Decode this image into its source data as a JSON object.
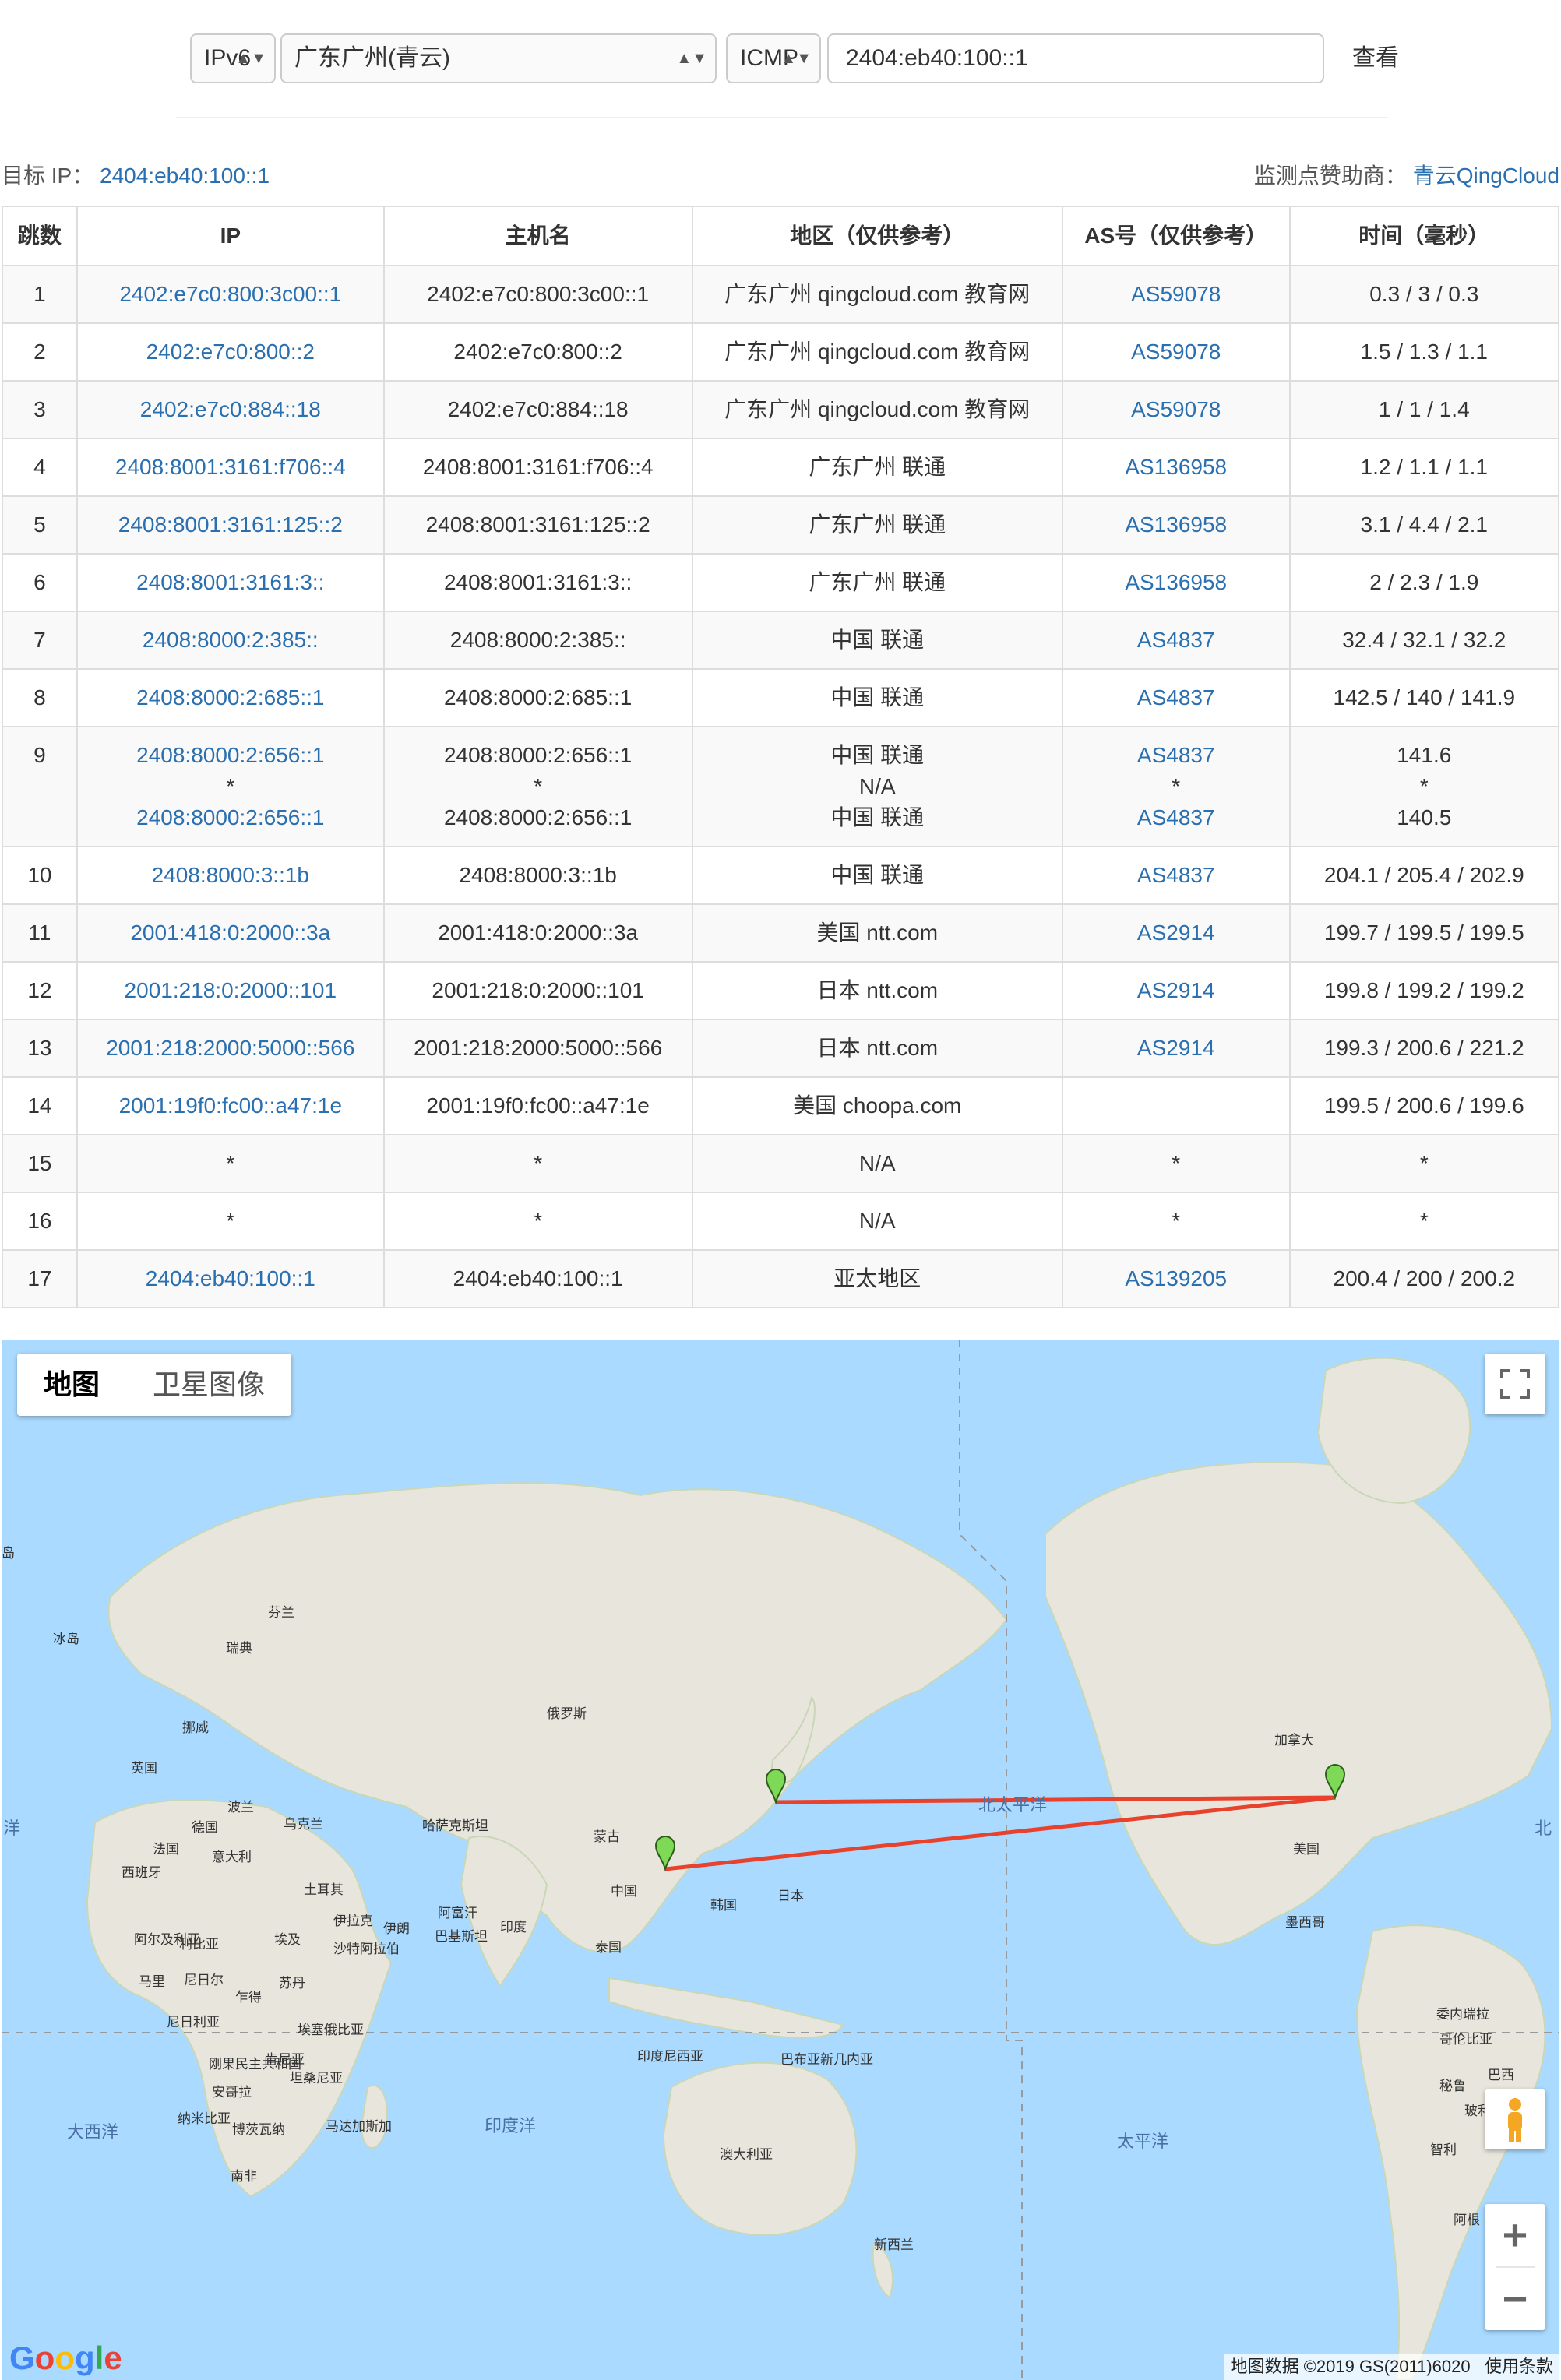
{
  "toolbar": {
    "protocol": "IPv6",
    "node": "广东广州(青云)",
    "method": "ICMP",
    "target_value": "2404:eb40:100::1",
    "submit_label": "查看"
  },
  "info": {
    "target_label": "目标 IP：",
    "target_ip": "2404:eb40:100::1",
    "sponsor_label": "监测点赞助商：",
    "sponsor_name": "青云QingCloud"
  },
  "table": {
    "headers": [
      "跳数",
      "IP",
      "主机名",
      "地区（仅供参考）",
      "AS号（仅供参考）",
      "时间（毫秒）"
    ],
    "rows": [
      {
        "hop": "1",
        "ip": [
          "2402:e7c0:800:3c00::1"
        ],
        "host": [
          "2402:e7c0:800:3c00::1"
        ],
        "region": [
          "广东广州 qingcloud.com 教育网"
        ],
        "as": [
          "AS59078"
        ],
        "time": [
          "0.3 / 3 / 0.3"
        ]
      },
      {
        "hop": "2",
        "ip": [
          "2402:e7c0:800::2"
        ],
        "host": [
          "2402:e7c0:800::2"
        ],
        "region": [
          "广东广州 qingcloud.com 教育网"
        ],
        "as": [
          "AS59078"
        ],
        "time": [
          "1.5 / 1.3 / 1.1"
        ]
      },
      {
        "hop": "3",
        "ip": [
          "2402:e7c0:884::18"
        ],
        "host": [
          "2402:e7c0:884::18"
        ],
        "region": [
          "广东广州 qingcloud.com 教育网"
        ],
        "as": [
          "AS59078"
        ],
        "time": [
          "1 / 1 / 1.4"
        ]
      },
      {
        "hop": "4",
        "ip": [
          "2408:8001:3161:f706::4"
        ],
        "host": [
          "2408:8001:3161:f706::4"
        ],
        "region": [
          "广东广州 联通"
        ],
        "as": [
          "AS136958"
        ],
        "time": [
          "1.2 / 1.1 / 1.1"
        ]
      },
      {
        "hop": "5",
        "ip": [
          "2408:8001:3161:125::2"
        ],
        "host": [
          "2408:8001:3161:125::2"
        ],
        "region": [
          "广东广州 联通"
        ],
        "as": [
          "AS136958"
        ],
        "time": [
          "3.1 / 4.4 / 2.1"
        ]
      },
      {
        "hop": "6",
        "ip": [
          "2408:8001:3161:3::"
        ],
        "host": [
          "2408:8001:3161:3::"
        ],
        "region": [
          "广东广州 联通"
        ],
        "as": [
          "AS136958"
        ],
        "time": [
          "2 / 2.3 / 1.9"
        ]
      },
      {
        "hop": "7",
        "ip": [
          "2408:8000:2:385::"
        ],
        "host": [
          "2408:8000:2:385::"
        ],
        "region": [
          "中国 联通"
        ],
        "as": [
          "AS4837"
        ],
        "time": [
          "32.4 / 32.1 / 32.2"
        ]
      },
      {
        "hop": "8",
        "ip": [
          "2408:8000:2:685::1"
        ],
        "host": [
          "2408:8000:2:685::1"
        ],
        "region": [
          "中国 联通"
        ],
        "as": [
          "AS4837"
        ],
        "time": [
          "142.5 / 140 / 141.9"
        ]
      },
      {
        "hop": "9",
        "ip": [
          "2408:8000:2:656::1",
          "*",
          "2408:8000:2:656::1"
        ],
        "host": [
          "2408:8000:2:656::1",
          "*",
          "2408:8000:2:656::1"
        ],
        "region": [
          "中国 联通",
          "N/A",
          "中国 联通"
        ],
        "as": [
          "AS4837",
          "*",
          "AS4837"
        ],
        "time": [
          "141.6",
          "*",
          "140.5"
        ]
      },
      {
        "hop": "10",
        "ip": [
          "2408:8000:3::1b"
        ],
        "host": [
          "2408:8000:3::1b"
        ],
        "region": [
          "中国 联通"
        ],
        "as": [
          "AS4837"
        ],
        "time": [
          "204.1 / 205.4 / 202.9"
        ]
      },
      {
        "hop": "11",
        "ip": [
          "2001:418:0:2000::3a"
        ],
        "host": [
          "2001:418:0:2000::3a"
        ],
        "region": [
          "美国 ntt.com"
        ],
        "as": [
          "AS2914"
        ],
        "time": [
          "199.7 / 199.5 / 199.5"
        ]
      },
      {
        "hop": "12",
        "ip": [
          "2001:218:0:2000::101"
        ],
        "host": [
          "2001:218:0:2000::101"
        ],
        "region": [
          "日本 ntt.com"
        ],
        "as": [
          "AS2914"
        ],
        "time": [
          "199.8 / 199.2 / 199.2"
        ]
      },
      {
        "hop": "13",
        "ip": [
          "2001:218:2000:5000::566"
        ],
        "host": [
          "2001:218:2000:5000::566"
        ],
        "region": [
          "日本 ntt.com"
        ],
        "as": [
          "AS2914"
        ],
        "time": [
          "199.3 / 200.6 / 221.2"
        ]
      },
      {
        "hop": "14",
        "ip": [
          "2001:19f0:fc00::a47:1e"
        ],
        "host": [
          "2001:19f0:fc00::a47:1e"
        ],
        "region": [
          "美国 choopa.com"
        ],
        "as": [
          ""
        ],
        "time": [
          "199.5 / 200.6 / 199.6"
        ]
      },
      {
        "hop": "15",
        "ip": [
          "*"
        ],
        "host": [
          "*"
        ],
        "region": [
          "N/A"
        ],
        "as": [
          "*"
        ],
        "time": [
          "*"
        ]
      },
      {
        "hop": "16",
        "ip": [
          "*"
        ],
        "host": [
          "*"
        ],
        "region": [
          "N/A"
        ],
        "as": [
          "*"
        ],
        "time": [
          "*"
        ]
      },
      {
        "hop": "17",
        "ip": [
          "2404:eb40:100::1"
        ],
        "host": [
          "2404:eb40:100::1"
        ],
        "region": [
          "亚太地区"
        ],
        "as": [
          "AS139205"
        ],
        "time": [
          "200.4 / 200 / 200.2"
        ]
      }
    ]
  },
  "map": {
    "tab_map": "地图",
    "tab_satellite": "卫星图像",
    "attribution": "地图数据 ©2019 GS(2011)6020",
    "terms": "使用条款",
    "logo": "Google",
    "zoom_in": "+",
    "zoom_out": "−",
    "route_color": "#e8412c",
    "labels": [
      {
        "text": "冰岛"
      },
      {
        "text": "芬兰"
      },
      {
        "text": "瑞典"
      },
      {
        "text": "挪威"
      },
      {
        "text": "英国"
      },
      {
        "text": "波兰"
      },
      {
        "text": "乌克兰"
      },
      {
        "text": "德国"
      },
      {
        "text": "法国"
      },
      {
        "text": "意大利"
      },
      {
        "text": "西班牙"
      },
      {
        "text": "俄罗斯"
      },
      {
        "text": "哈萨克斯坦"
      },
      {
        "text": "蒙古"
      },
      {
        "text": "中国"
      },
      {
        "text": "韩国"
      },
      {
        "text": "日本"
      },
      {
        "text": "土耳其"
      },
      {
        "text": "伊拉克"
      },
      {
        "text": "伊朗"
      },
      {
        "text": "阿富汗"
      },
      {
        "text": "巴基斯坦"
      },
      {
        "text": "印度"
      },
      {
        "text": "泰国"
      },
      {
        "text": "沙特阿拉伯"
      },
      {
        "text": "埃及"
      },
      {
        "text": "阿尔及利亚"
      },
      {
        "text": "利比亚"
      },
      {
        "text": "马里"
      },
      {
        "text": "尼日尔"
      },
      {
        "text": "苏丹"
      },
      {
        "text": "乍得"
      },
      {
        "text": "尼日利亚"
      },
      {
        "text": "埃塞俄比亚"
      },
      {
        "text": "刚果民主共和国"
      },
      {
        "text": "肯尼亚"
      },
      {
        "text": "坦桑尼亚"
      },
      {
        "text": "安哥拉"
      },
      {
        "text": "纳米比亚"
      },
      {
        "text": "博茨瓦纳"
      },
      {
        "text": "南非"
      },
      {
        "text": "马达加斯加"
      },
      {
        "text": "印度尼西亚"
      },
      {
        "text": "巴布亚新几内亚"
      },
      {
        "text": "澳大利亚"
      },
      {
        "text": "新西兰"
      },
      {
        "text": "加拿大"
      },
      {
        "text": "美国"
      },
      {
        "text": "墨西哥"
      },
      {
        "text": "委内瑞拉"
      },
      {
        "text": "哥伦比亚"
      },
      {
        "text": "秘鲁"
      },
      {
        "text": "巴西"
      },
      {
        "text": "玻利维亚"
      },
      {
        "text": "智利"
      },
      {
        "text": "阿根"
      },
      {
        "text": "岛"
      }
    ],
    "oceans": [
      {
        "text": "北太平洋"
      },
      {
        "text": "太平洋"
      },
      {
        "text": "印度洋"
      },
      {
        "text": "大西洋"
      },
      {
        "text": "洋"
      },
      {
        "text": "北"
      }
    ]
  }
}
